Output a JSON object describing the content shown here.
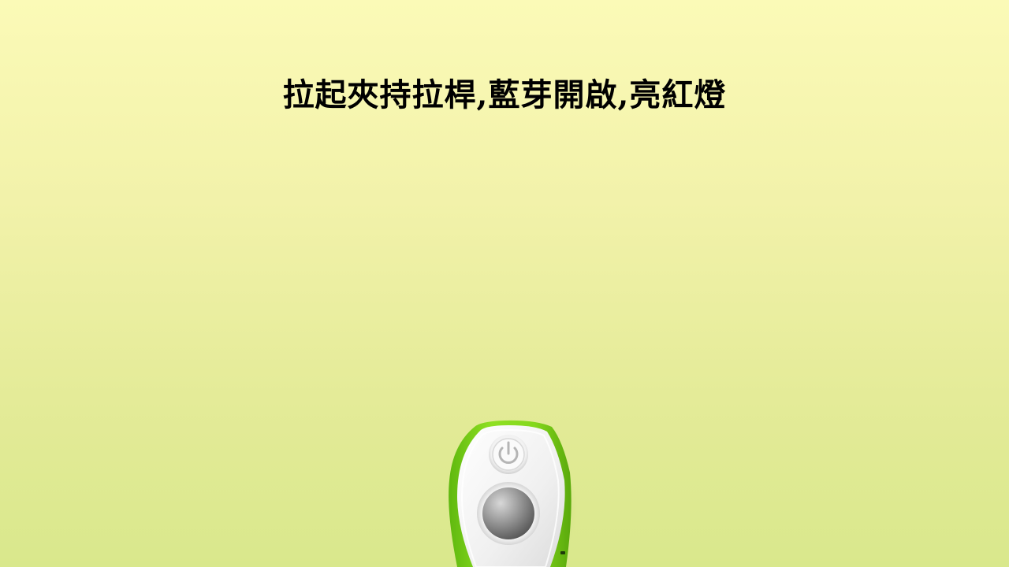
{
  "title": "拉起夾持拉桿,藍芽開啟,亮紅燈",
  "colors": {
    "background_top": "#fbfab7",
    "background_bottom": "#d9e88c",
    "device_shell": "#7fd31c",
    "device_face": "#f2f2f2",
    "center_button": "#8a8a8a"
  },
  "icons": {
    "power": "power-icon"
  }
}
